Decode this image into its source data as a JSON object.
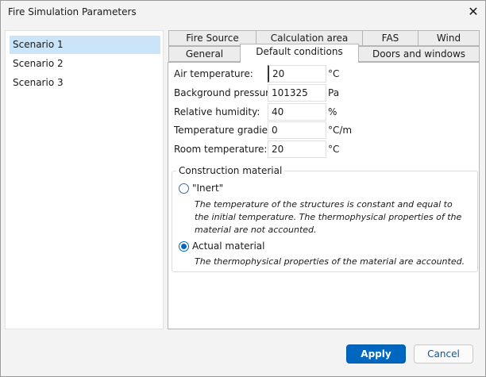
{
  "window": {
    "title": "Fire Simulation Parameters"
  },
  "scenarios": [
    "Scenario 1",
    "Scenario 2",
    "Scenario 3"
  ],
  "tabs": {
    "row1": [
      "Fire Source",
      "Calculation area",
      "FAS",
      "Wind"
    ],
    "row2": [
      "General",
      "Default conditions",
      "Doors and windows"
    ],
    "active": "Default conditions"
  },
  "fields": [
    {
      "label": "Air temperature:",
      "value": "20",
      "unit": "°C"
    },
    {
      "label": "Background pressure:",
      "value": "101325",
      "unit": "Pa"
    },
    {
      "label": "Relative humidity:",
      "value": "40",
      "unit": "%"
    },
    {
      "label": "Temperature gradient:",
      "value": "0",
      "unit": "°C/m"
    },
    {
      "label": "Room temperature:",
      "value": "20",
      "unit": "°C"
    }
  ],
  "construction": {
    "legend": "Construction material",
    "options": [
      {
        "label": "\"Inert\"",
        "description": "The temperature of the structures is constant and equal to the initial temperature. The thermophysical properties of the material are not accounted.",
        "selected": false
      },
      {
        "label": "Actual material",
        "description": "The thermophysical properties of the material are accounted.",
        "selected": true
      }
    ]
  },
  "buttons": {
    "apply": "Apply",
    "cancel": "Cancel"
  },
  "colors": {
    "accent": "#0067c0",
    "selection": "#cce4f7"
  }
}
